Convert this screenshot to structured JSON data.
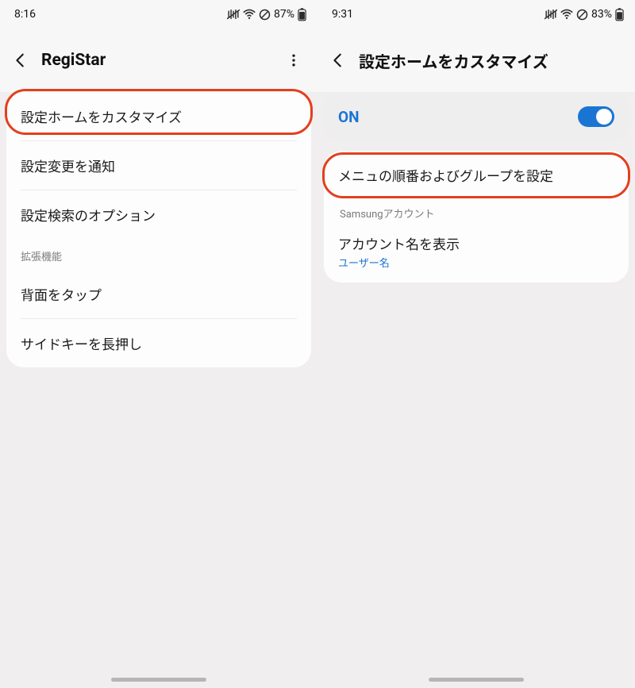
{
  "left": {
    "clock": "8:16",
    "battery_text": "87%",
    "title": "RegiStar",
    "rows": {
      "customize": "設定ホームをカスタマイズ",
      "notify": "設定変更を通知",
      "search_opt": "設定検索のオプション"
    },
    "section_label": "拡張機能",
    "ext_rows": {
      "back_tap": "背面をタップ",
      "side_key": "サイドキーを長押し"
    }
  },
  "right": {
    "clock": "9:31",
    "battery_text": "83%",
    "title": "設定ホームをカスタマイズ",
    "toggle_label": "ON",
    "menu_row": "メニュの順番およびグループを設定",
    "account_section": "Samsungアカウント",
    "account_title": "アカウント名を表示",
    "account_sub": "ユーザー名"
  }
}
